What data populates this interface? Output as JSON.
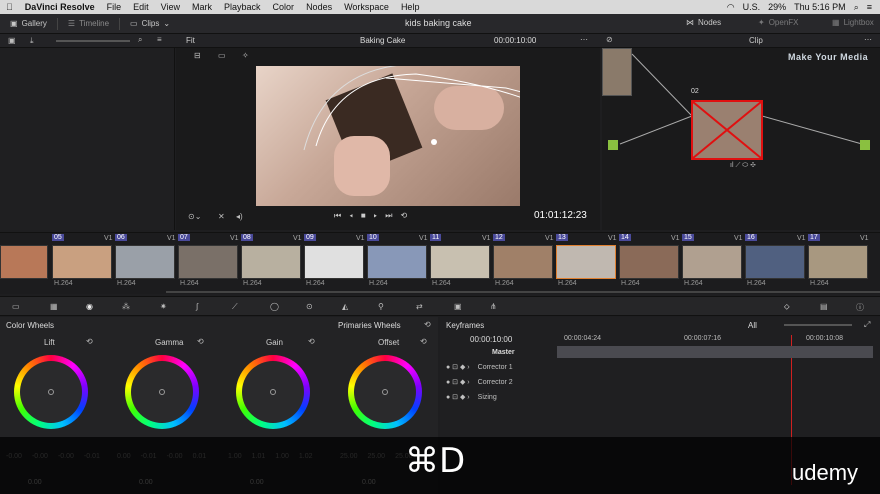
{
  "menubar": {
    "apple": "",
    "app": "DaVinci Resolve",
    "items": [
      "File",
      "Edit",
      "View",
      "Mark",
      "Playback",
      "Color",
      "Nodes",
      "Workspace",
      "Help"
    ],
    "flag": "U.S.",
    "battery": "29%",
    "clock": "Thu 5:16 PM"
  },
  "topbar": {
    "gallery": "Gallery",
    "timeline": "Timeline",
    "clips": "Clips",
    "project": "kids baking cake",
    "nodes": "Nodes",
    "openfx": "OpenFX",
    "lightbox": "Lightbox"
  },
  "viewer": {
    "fit": "Fit",
    "clip_name": "Baking Cake",
    "src_tc": "00:00:10:00",
    "timecode": "01:01:12:23"
  },
  "node_panel": {
    "mode": "Clip",
    "node_label": "02"
  },
  "watermark": "Make Your Media",
  "timeline": {
    "clips": [
      {
        "num": "05"
      },
      {
        "num": "06"
      },
      {
        "num": "07"
      },
      {
        "num": "08"
      },
      {
        "num": "09"
      },
      {
        "num": "10"
      },
      {
        "num": "11"
      },
      {
        "num": "12"
      },
      {
        "num": "13"
      },
      {
        "num": "14"
      },
      {
        "num": "15"
      },
      {
        "num": "16"
      },
      {
        "num": "17"
      }
    ],
    "track": "V1",
    "codec": "H.264"
  },
  "color_wheels": {
    "title": "Color Wheels",
    "mode": "Primaries Wheels",
    "wheels": [
      {
        "name": "Lift",
        "vals": [
          "-0.00",
          "-0.00",
          "-0.00",
          "-0.01"
        ]
      },
      {
        "name": "Gamma",
        "vals": [
          "0.00",
          "-0.01",
          "-0.00",
          "0.01"
        ]
      },
      {
        "name": "Gain",
        "vals": [
          "1.00",
          "1.01",
          "1.00",
          "1.02"
        ]
      },
      {
        "name": "Offset",
        "vals": [
          "25.00",
          "25.00",
          "25.00"
        ]
      }
    ],
    "bottom_vals": [
      "0.00",
      "0.00",
      "0.00",
      "0.00"
    ]
  },
  "keyframes": {
    "title": "Keyframes",
    "filter": "All",
    "tc": "00:00:10:00",
    "marks": [
      "00:00:04:24",
      "00:00:07:16",
      "00:00:10:08"
    ],
    "rows": [
      "Master",
      "Corrector 1",
      "Corrector 2",
      "Sizing"
    ]
  },
  "overlay": {
    "shortcut": "⌘D",
    "brand": "udemy"
  }
}
